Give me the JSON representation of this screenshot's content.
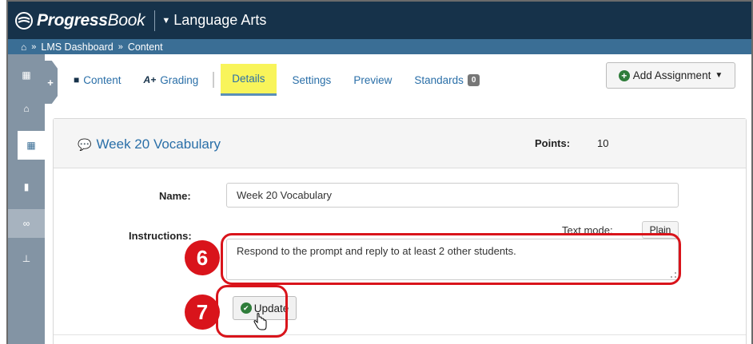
{
  "app": {
    "brand_bold": "Progress",
    "brand_rest": "Book",
    "course": "Language Arts"
  },
  "breadcrumb": {
    "items": [
      "LMS Dashboard",
      "Content"
    ]
  },
  "tabs": [
    {
      "label": "Content",
      "icon": "folder-icon"
    },
    {
      "label": "Grading",
      "icon": "grade-icon"
    },
    {
      "label": "Details",
      "active": true
    },
    {
      "label": "Settings"
    },
    {
      "label": "Preview"
    },
    {
      "label": "Standards",
      "badge": "0"
    }
  ],
  "toolbar": {
    "add_assignment": "Add Assignment"
  },
  "assignment": {
    "title": "Week 20 Vocabulary",
    "points_label": "Points:",
    "points_value": "10"
  },
  "form": {
    "name_label": "Name:",
    "name_value": "Week 20 Vocabulary",
    "instructions_label": "Instructions:",
    "text_mode_label": "Text mode:",
    "text_mode_value": "Plain",
    "instructions_value": "Respond to the prompt and reply to at least 2 other students.",
    "update_label": "Update"
  },
  "callouts": {
    "step6": "6",
    "step7": "7"
  },
  "colors": {
    "topbar": "#16324a",
    "breadcrumb_bar": "#3a6e95",
    "sidebar": "#8394a4",
    "link": "#2a6fa8",
    "highlight": "#f8f45a",
    "callout": "#d9141b",
    "success": "#2f7d3a"
  }
}
